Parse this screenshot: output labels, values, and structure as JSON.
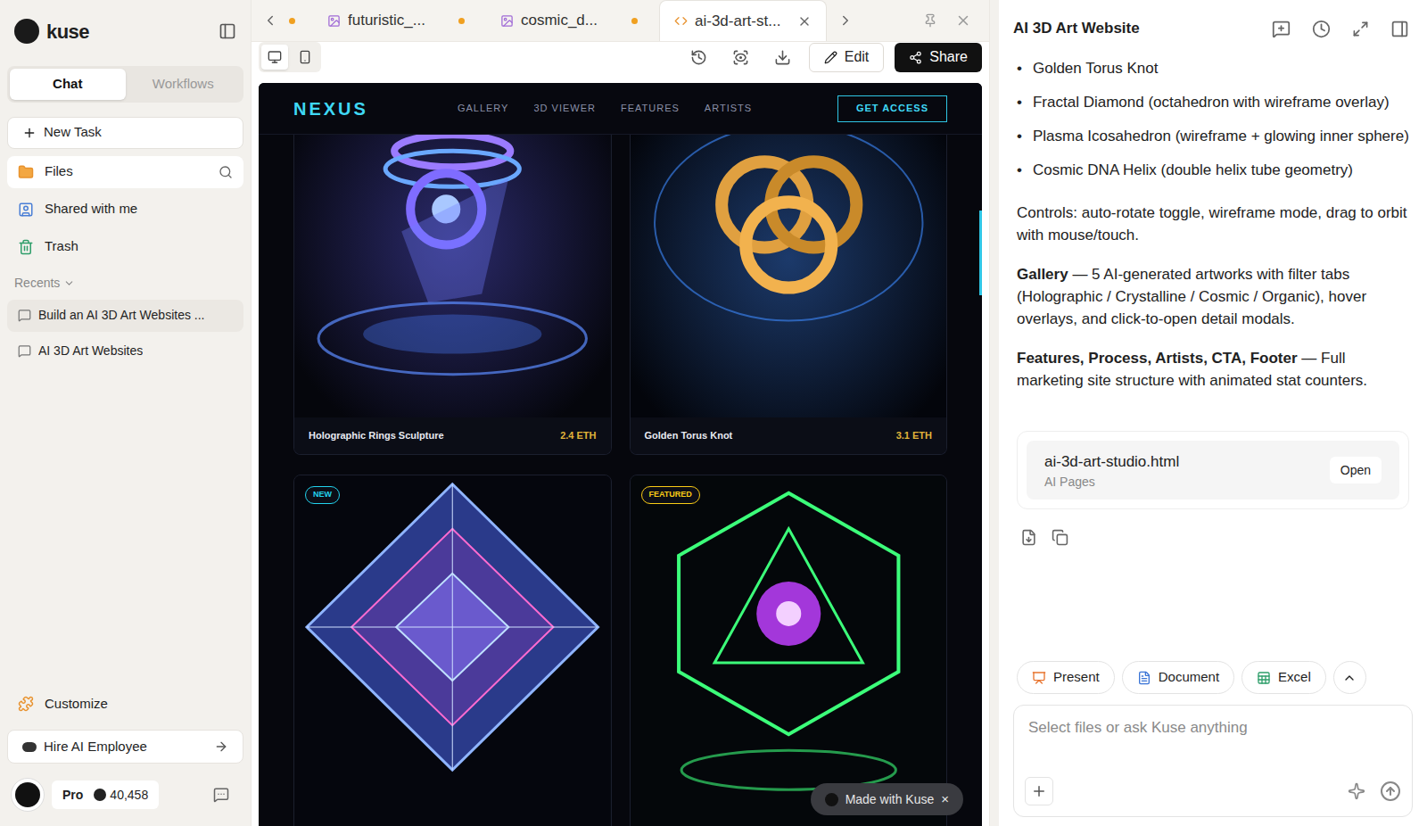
{
  "sidebar": {
    "brand": "kuse",
    "tabs": [
      {
        "label": "Chat",
        "selected": true
      },
      {
        "label": "Workflows",
        "selected": false
      }
    ],
    "new_task": "New Task",
    "nav": [
      {
        "label": "Files",
        "selected": true
      },
      {
        "label": "Shared with me",
        "selected": false
      },
      {
        "label": "Trash",
        "selected": false
      }
    ],
    "recents_label": "Recents",
    "recents": [
      {
        "label": "Build an AI 3D Art Websites ...",
        "selected": true
      },
      {
        "label": "AI 3D Art Websites",
        "selected": false
      }
    ],
    "customize": "Customize",
    "hire": "Hire AI Employee",
    "plan": "Pro",
    "credits": "40,458"
  },
  "editor": {
    "tabs": [
      {
        "label": "futuristic_...",
        "kind": "image",
        "modified": true,
        "selected": false
      },
      {
        "label": "cosmic_d...",
        "kind": "image",
        "modified": true,
        "selected": false
      },
      {
        "label": "ai-3d-art-st...",
        "kind": "code",
        "modified": false,
        "selected": true
      }
    ],
    "view_modes": [
      {
        "mode": "desktop",
        "selected": true
      },
      {
        "mode": "mobile",
        "selected": false
      }
    ],
    "edit": "Edit",
    "share": "Share"
  },
  "preview": {
    "logo": "NEXUS",
    "nav": [
      "GALLERY",
      "3D VIEWER",
      "FEATURES",
      "ARTISTS"
    ],
    "cta": "GET ACCESS",
    "cards": [
      {
        "title": "Holographic Rings Sculpture",
        "price": "2.4 ETH"
      },
      {
        "title": "Golden Torus Knot",
        "price": "3.1 ETH"
      },
      {
        "badge": {
          "label": "NEW",
          "color": "#22d3ee"
        }
      },
      {
        "badge": {
          "label": "FEATURED",
          "color": "#facc15"
        }
      }
    ],
    "made_with": "Made with Kuse",
    "close": "×"
  },
  "chat": {
    "title": "AI 3D Art Website",
    "bullets": [
      "Golden Torus Knot",
      "Fractal Diamond (octahedron with wireframe overlay)",
      "Plasma Icosahedron (wireframe + glowing inner sphere)",
      "Cosmic DNA Helix (double helix tube geometry)"
    ],
    "paragraphs": [
      {
        "text": "Controls: auto-rotate toggle, wireframe mode, drag to orbit with mouse/touch."
      },
      {
        "lead": "Gallery",
        "text": " — 5 AI-generated artworks with filter tabs (Holographic / Crystalline / Cosmic / Organic), hover overlays, and click-to-open detail modals."
      },
      {
        "lead": "Features, Process, Artists, CTA, Footer",
        "text": " — Full marketing site structure with animated stat counters."
      }
    ],
    "file": {
      "name": "ai-3d-art-studio.html",
      "type": "AI Pages",
      "action": "Open"
    },
    "chips": [
      "Present",
      "Document",
      "Excel"
    ],
    "input": {
      "placeholder": "Select files or ask Kuse anything"
    }
  }
}
